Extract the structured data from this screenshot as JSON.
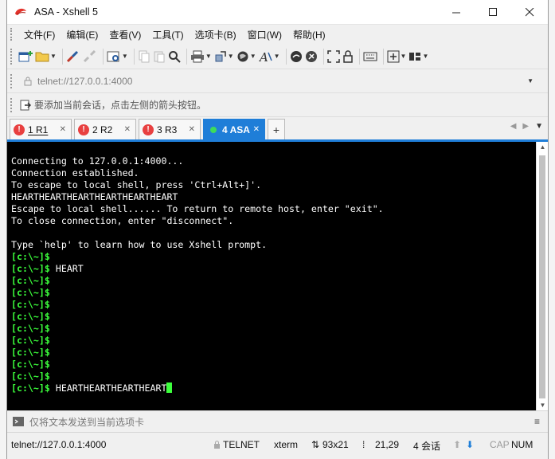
{
  "window": {
    "title": "ASA - Xshell 5",
    "minimize_icon": "minimize-icon",
    "maximize_icon": "maximize-icon",
    "close_icon": "close-icon"
  },
  "menu": [
    {
      "label": "文件(F)"
    },
    {
      "label": "编辑(E)"
    },
    {
      "label": "查看(V)"
    },
    {
      "label": "工具(T)"
    },
    {
      "label": "选项卡(B)"
    },
    {
      "label": "窗口(W)"
    },
    {
      "label": "帮助(H)"
    }
  ],
  "address": {
    "value": "telnet://127.0.0.1:4000"
  },
  "hint": {
    "text": "要添加当前会话，点击左侧的箭头按钮。"
  },
  "tabs": [
    {
      "label": "1 R1",
      "status": "warning"
    },
    {
      "label": "2 R2",
      "status": "warning"
    },
    {
      "label": "3 R3",
      "status": "warning"
    },
    {
      "label": "4 ASA",
      "status": "connected",
      "active": true
    }
  ],
  "terminal": {
    "lines": [
      "Connecting to 127.0.0.1:4000...",
      "Connection established.",
      "To escape to local shell, press 'Ctrl+Alt+]'.",
      "HEARTHEARTHEARTHEARTHEARTHEART",
      "Escape to local shell...... To return to remote host, enter \"exit\".",
      "To close connection, enter \"disconnect\".",
      "",
      "Type `help' to learn how to use Xshell prompt."
    ],
    "prompt": "[c:\\~]$",
    "prompt_lines": [
      "",
      " HEART",
      "",
      "",
      "",
      "",
      "",
      "",
      "",
      "",
      ""
    ],
    "current_input": " HEARTHEARTHEARTHEART"
  },
  "compose": {
    "placeholder": "仅将文本发送到当前选项卡"
  },
  "status": {
    "connection": "telnet://127.0.0.1:4000",
    "protocol": "TELNET",
    "terminal_type": "xterm",
    "size": "93x21",
    "cursor_pos": "21,29",
    "sessions": "4 会话",
    "caps": "CAP",
    "num": "NUM"
  },
  "colors": {
    "accent": "#1f7ed8",
    "prompt_green": "#3cff3c",
    "terminal_bg": "#000000"
  }
}
